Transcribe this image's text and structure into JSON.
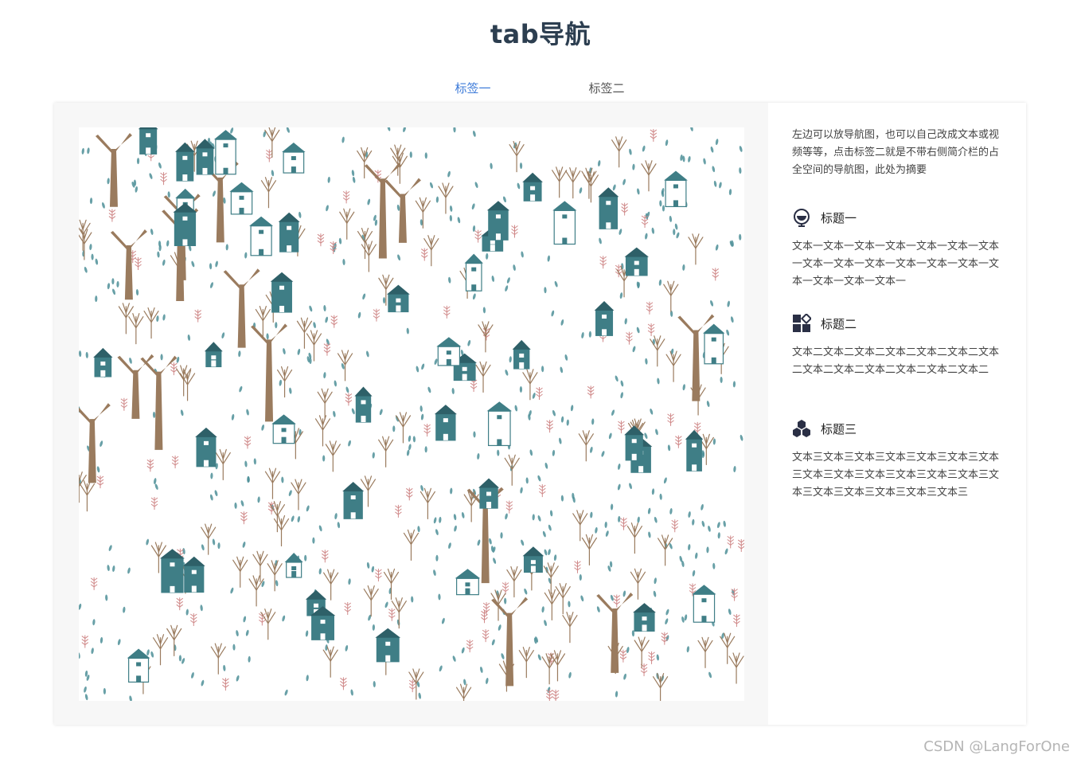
{
  "page": {
    "title": "tab导航"
  },
  "tabs": [
    {
      "label": "标签一",
      "active": true
    },
    {
      "label": "标签二",
      "active": false
    }
  ],
  "illustration": {
    "description_icon": "house-and-tree-pattern"
  },
  "sidebar": {
    "summary": "左边可以放导航图，也可以自己改成文本或视频等等，点击标签二就是不带右侧简介栏的占全空间的导航图，此处为摘要",
    "sections": [
      {
        "icon": "globe-icon",
        "title": "标题一",
        "body": "文本一文本一文本一文本一文本一文本一文本一文本一文本一文本一文本一文本一文本一文本一文本一文本一文本一"
      },
      {
        "icon": "grid-icon",
        "title": "标题二",
        "body": "文本二文本二文本二文本二文本二文本二文本二文本二文本二文本二文本二文本二文本二"
      },
      {
        "icon": "hexagons-icon",
        "title": "标题三",
        "body": "文本三文本三文本三文本三文本三文本三文本三文本三文本三文本三文本三文本三文本三文本三文本三文本三文本三文本三文本三"
      }
    ]
  },
  "colors": {
    "accent": "#2f75e6",
    "house": "#3f7e86",
    "trunk": "#9a7b5e",
    "leaf": "#4d8f98",
    "sprig": "#d08a8a"
  },
  "watermark": "CSDN @LangForOne"
}
